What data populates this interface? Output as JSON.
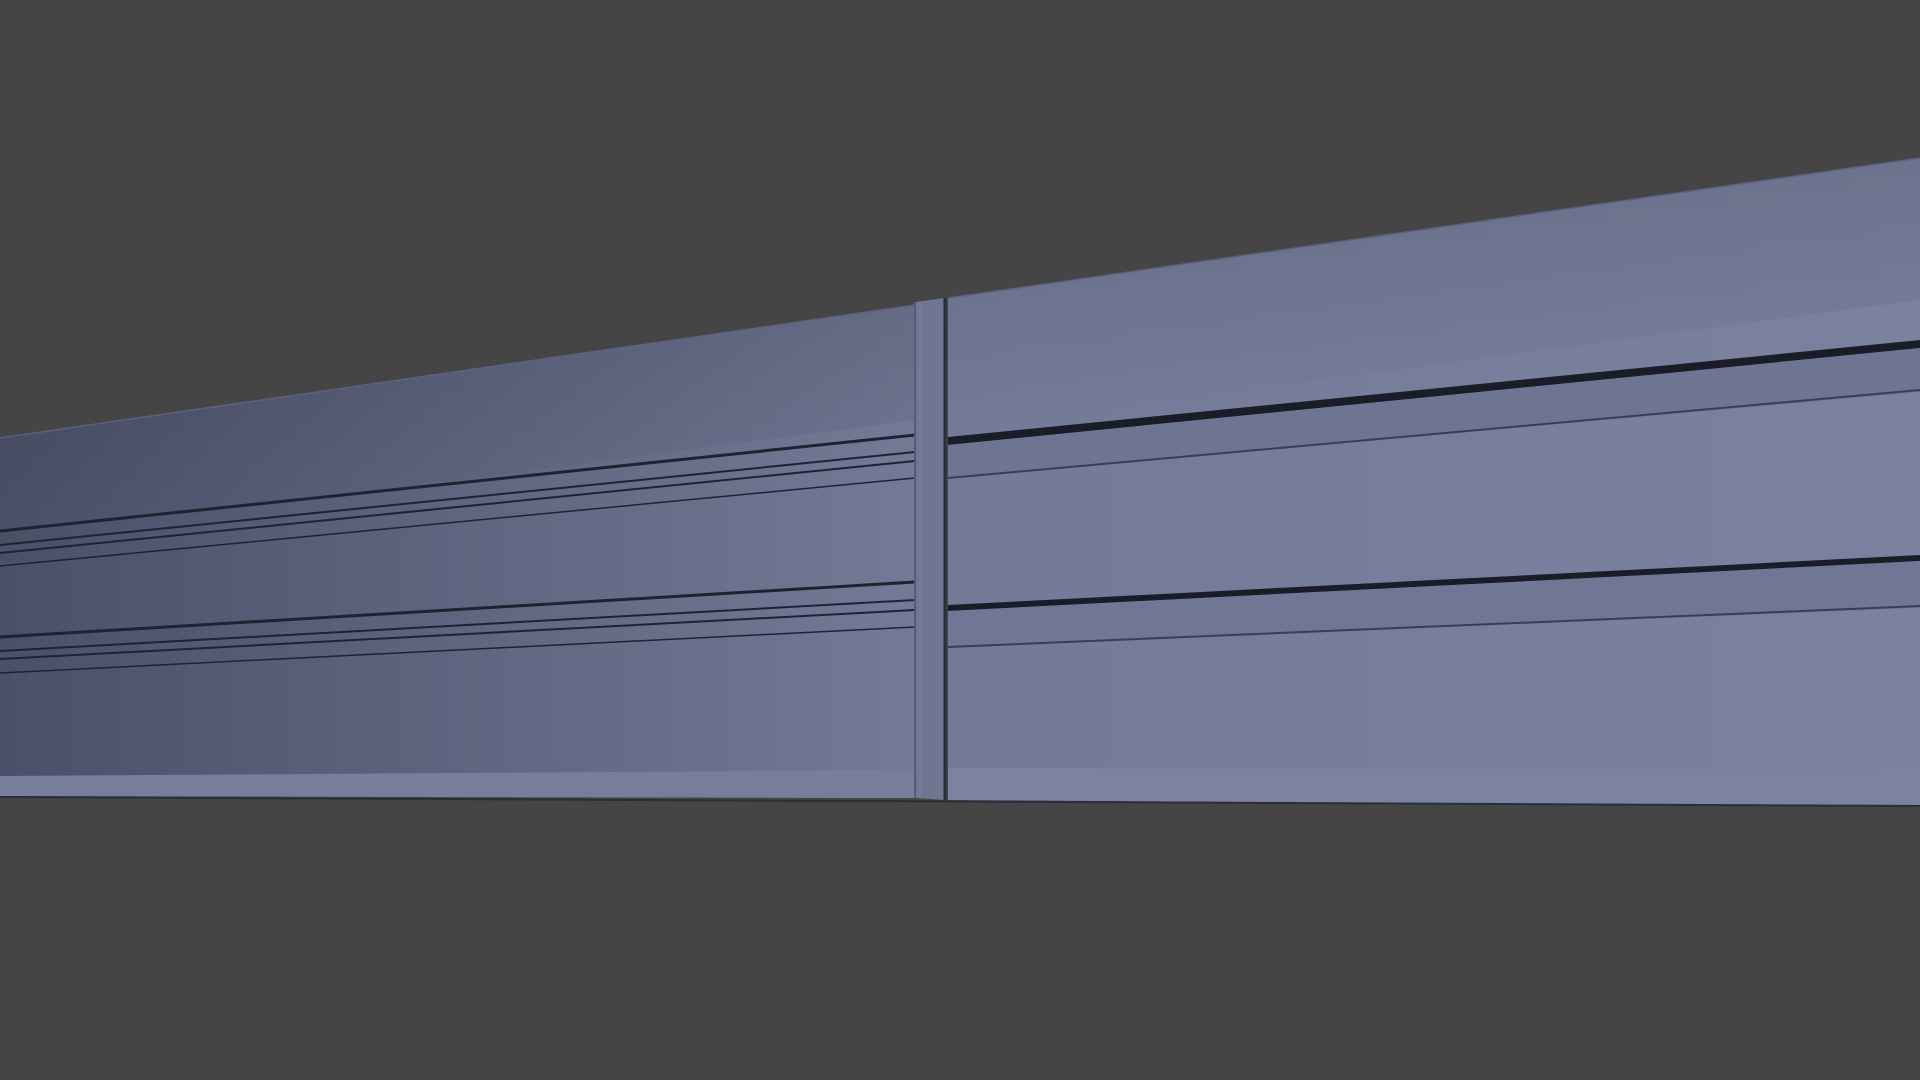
{
  "scene": {
    "background_color": "#454545",
    "subject": "wall-panel-model",
    "panel_color": "#737a97",
    "panel_shadow_color": "#4a5068",
    "panel_highlight_color": "#8088a6",
    "groove_color": "#1f2230",
    "separator_color": "#6f7692"
  }
}
